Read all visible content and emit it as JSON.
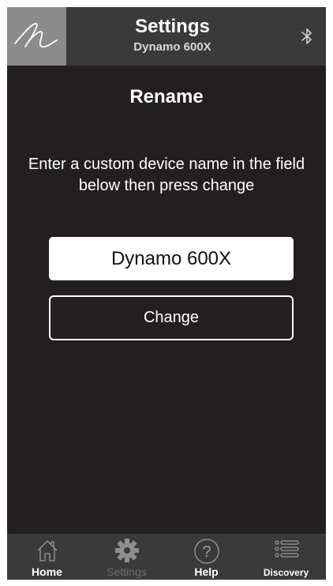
{
  "header": {
    "title": "Settings",
    "subtitle": "Dynamo 600X",
    "logo_icon": "signature-logo-icon",
    "bluetooth_icon": "bluetooth-icon"
  },
  "main": {
    "section_title": "Rename",
    "instructions": "Enter a custom device name in the field below then press change",
    "name_field_value": "Dynamo 600X",
    "change_label": "Change"
  },
  "tabs": [
    {
      "label": "Home",
      "icon": "home-icon",
      "state": "active"
    },
    {
      "label": "Settings",
      "icon": "gear-icon",
      "state": "disabled"
    },
    {
      "label": "Help",
      "icon": "help-icon",
      "state": "active"
    },
    {
      "label": "Discovery",
      "icon": "list-icon",
      "state": "active"
    }
  ],
  "colors": {
    "background": "#231f20",
    "bar": "#3a3a3a",
    "logo_bg": "#8c8c8c",
    "text": "#ffffff",
    "disabled": "#6e6e6e"
  }
}
